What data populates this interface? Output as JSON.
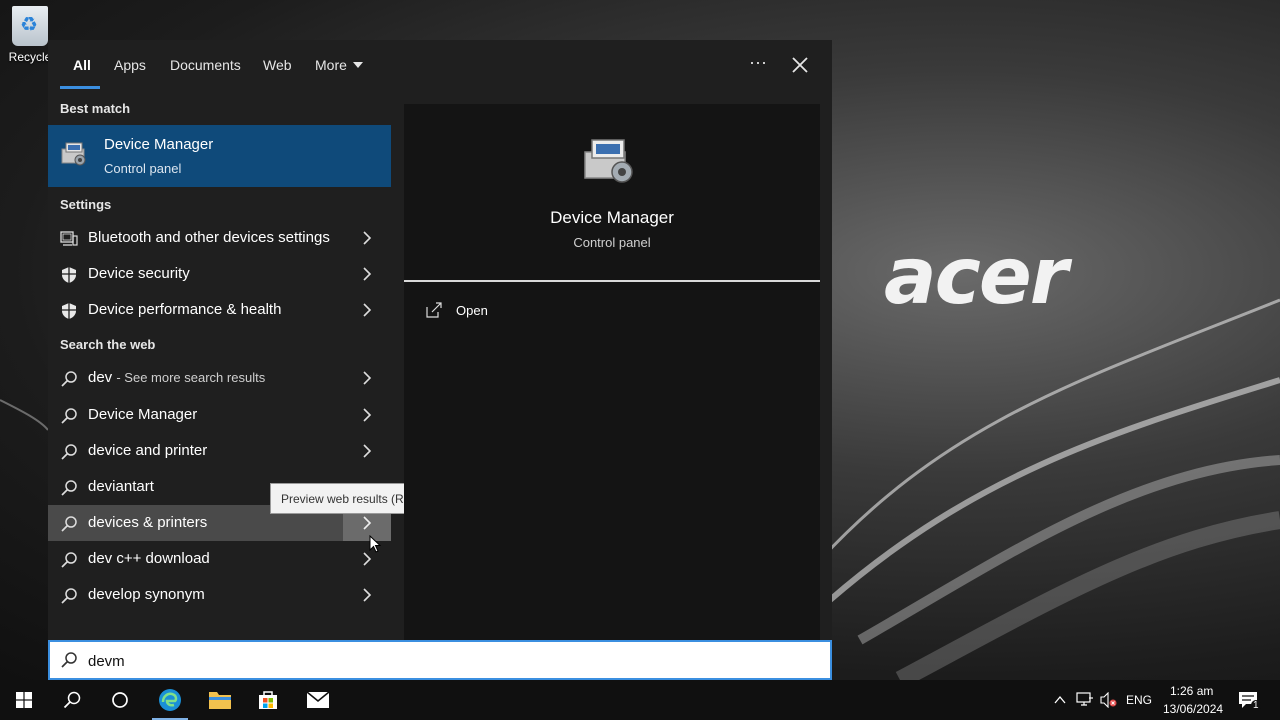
{
  "desktop": {
    "recycle_label": "Recycle",
    "brand": "acer"
  },
  "tabs": [
    {
      "label": "All",
      "active": true
    },
    {
      "label": "Apps"
    },
    {
      "label": "Documents"
    },
    {
      "label": "Web"
    },
    {
      "label": "More"
    }
  ],
  "sections": {
    "best_match": "Best match",
    "settings": "Settings",
    "web": "Search the web"
  },
  "best_match": {
    "title": "Device Manager",
    "subtitle": "Control panel"
  },
  "settings_items": [
    {
      "label": "Bluetooth and other devices settings"
    },
    {
      "label": "Device security"
    },
    {
      "label": "Device performance & health"
    }
  ],
  "web_items": [
    {
      "label": "dev",
      "suffix": "- See more search results"
    },
    {
      "label": "Device Manager"
    },
    {
      "label": "device and printer"
    },
    {
      "label": "deviantart"
    },
    {
      "label": "devices & printers"
    },
    {
      "label": "dev c++ download"
    },
    {
      "label": "develop synonym"
    }
  ],
  "tooltip": "Preview web results (Right arrow)",
  "preview": {
    "title": "Device Manager",
    "subtitle": "Control panel",
    "action_open": "Open"
  },
  "search": {
    "value": "devm"
  },
  "tray": {
    "language": "ENG",
    "time": "1:26 am",
    "date": "13/06/2024",
    "notification_count": "1"
  },
  "colors": {
    "accent": "#3b8fe0",
    "selected": "#0f4a7a",
    "panel": "#1f1f1f"
  }
}
